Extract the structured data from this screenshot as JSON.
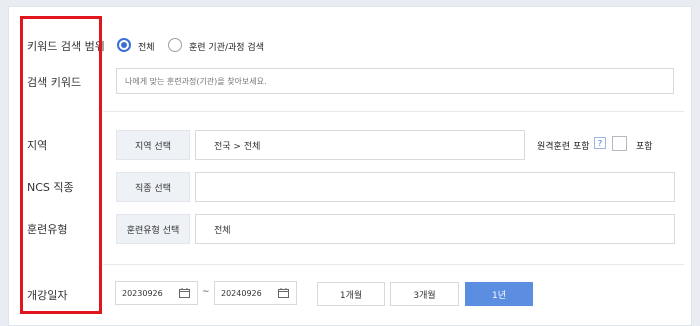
{
  "form": {
    "keyword_scope": {
      "label": "키워드 검색 범위",
      "options": [
        {
          "label": "전체",
          "selected": true
        },
        {
          "label": "훈련 기관/과정 검색",
          "selected": false
        }
      ]
    },
    "keyword": {
      "label": "검색 키워드",
      "placeholder": "나에게 맞는 훈련과정(기관)을 찾아보세요."
    },
    "region": {
      "label": "지역",
      "button": "지역 선택",
      "value": "전국 > 전체",
      "remote_label": "원격훈련 포함",
      "help": "?",
      "include_label": "포함"
    },
    "ncs": {
      "label": "NCS 직종",
      "button": "직종 선택",
      "value": ""
    },
    "training_type": {
      "label": "훈련유형",
      "button": "훈련유형 선택",
      "value": "전체"
    },
    "start_date": {
      "label": "개강일자",
      "from": "20230926",
      "to": "20240926",
      "separator": "~",
      "periods": [
        {
          "label": "1개월",
          "active": false
        },
        {
          "label": "3개월",
          "active": false
        },
        {
          "label": "1년",
          "active": true
        }
      ]
    }
  },
  "colors": {
    "accent": "#3a6fd8",
    "active_button": "#5b8ee0",
    "highlight": "#e0161c"
  }
}
